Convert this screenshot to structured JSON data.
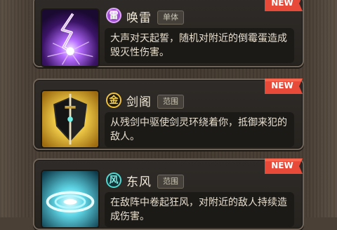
{
  "skills": [
    {
      "element": "雷",
      "name": "唤雷",
      "tag": "单体",
      "new_label": "NEW",
      "description": "大声对天起誓，随机对附近的倒霉蛋造成毁灭性伤害。",
      "element_color": "#a04fd0"
    },
    {
      "element": "金",
      "name": "剑阁",
      "tag": "范围",
      "new_label": "NEW",
      "description": "从残剑中驱使剑灵环绕着你，抵御来犯的敌人。",
      "element_color": "#f0c23a"
    },
    {
      "element": "风",
      "name": "东风",
      "tag": "范围",
      "new_label": "NEW",
      "description": "在敌阵中卷起狂风，对附近的敌人持续造成伤害。",
      "element_color": "#4fd8d0"
    }
  ],
  "colors": {
    "new_badge": "#e84a3a",
    "frame": "#6e6358",
    "card_bg": "#2a2622"
  }
}
